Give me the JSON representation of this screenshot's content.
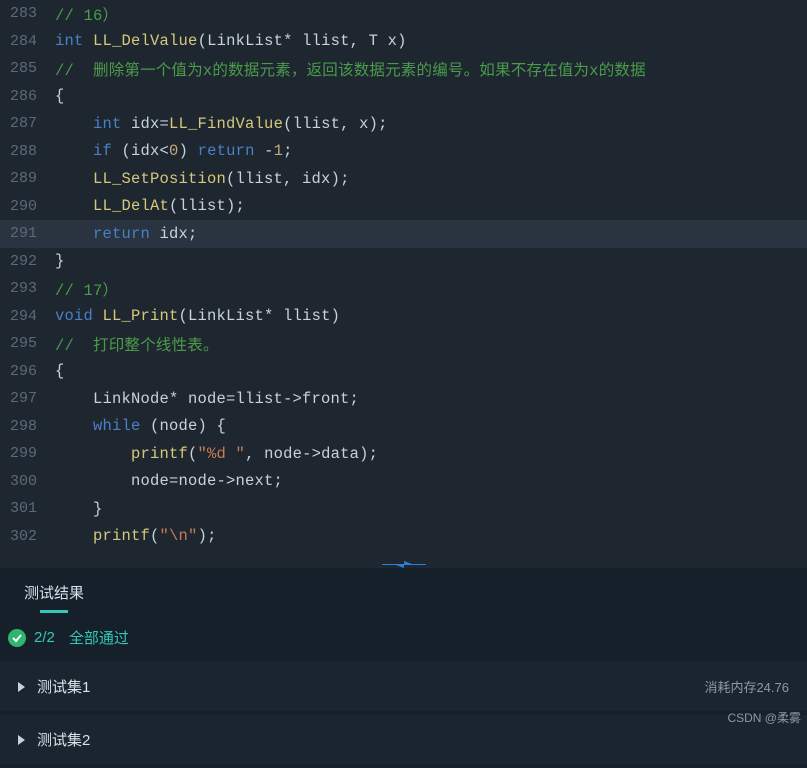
{
  "code": {
    "lines": [
      {
        "num": "283",
        "active": false,
        "tokens": [
          {
            "t": "// 16）",
            "c": "tok-com"
          }
        ]
      },
      {
        "num": "284",
        "active": false,
        "tokens": [
          {
            "t": "int",
            "c": "tok-kw"
          },
          {
            "t": " ",
            "c": "tok-op"
          },
          {
            "t": "LL_DelValue",
            "c": "tok-fn"
          },
          {
            "t": "(LinkList* llist, T x)",
            "c": "tok-pun"
          }
        ]
      },
      {
        "num": "285",
        "active": false,
        "tokens": [
          {
            "t": "//  删除第一个值为x的数据元素，返回该数据元素的编号。如果不存在值为x的数据",
            "c": "tok-com"
          }
        ]
      },
      {
        "num": "286",
        "active": false,
        "tokens": [
          {
            "t": "{",
            "c": "tok-pun"
          }
        ]
      },
      {
        "num": "287",
        "active": false,
        "tokens": [
          {
            "t": "    ",
            "c": "tok-op"
          },
          {
            "t": "int",
            "c": "tok-kw"
          },
          {
            "t": " idx=",
            "c": "tok-id"
          },
          {
            "t": "LL_FindValue",
            "c": "tok-fn"
          },
          {
            "t": "(llist, x);",
            "c": "tok-pun"
          }
        ]
      },
      {
        "num": "288",
        "active": false,
        "tokens": [
          {
            "t": "    ",
            "c": "tok-op"
          },
          {
            "t": "if",
            "c": "tok-kw"
          },
          {
            "t": " (idx<",
            "c": "tok-pun"
          },
          {
            "t": "0",
            "c": "tok-num"
          },
          {
            "t": ") ",
            "c": "tok-pun"
          },
          {
            "t": "return",
            "c": "tok-kw"
          },
          {
            "t": " -",
            "c": "tok-pun"
          },
          {
            "t": "1",
            "c": "tok-num"
          },
          {
            "t": ";",
            "c": "tok-pun"
          }
        ]
      },
      {
        "num": "289",
        "active": false,
        "tokens": [
          {
            "t": "    ",
            "c": "tok-op"
          },
          {
            "t": "LL_SetPosition",
            "c": "tok-fn"
          },
          {
            "t": "(llist, idx);",
            "c": "tok-pun"
          }
        ]
      },
      {
        "num": "290",
        "active": false,
        "tokens": [
          {
            "t": "    ",
            "c": "tok-op"
          },
          {
            "t": "LL_DelAt",
            "c": "tok-fn"
          },
          {
            "t": "(llist);",
            "c": "tok-pun"
          }
        ]
      },
      {
        "num": "291",
        "active": true,
        "tokens": [
          {
            "t": "    ",
            "c": "tok-op"
          },
          {
            "t": "return",
            "c": "tok-kw"
          },
          {
            "t": " idx;",
            "c": "tok-pun"
          }
        ]
      },
      {
        "num": "292",
        "active": false,
        "tokens": [
          {
            "t": "}",
            "c": "tok-pun"
          }
        ]
      },
      {
        "num": "293",
        "active": false,
        "tokens": [
          {
            "t": "// 17）",
            "c": "tok-com"
          }
        ]
      },
      {
        "num": "294",
        "active": false,
        "tokens": [
          {
            "t": "void",
            "c": "tok-kw"
          },
          {
            "t": " ",
            "c": "tok-op"
          },
          {
            "t": "LL_Print",
            "c": "tok-fn"
          },
          {
            "t": "(LinkList* llist)",
            "c": "tok-pun"
          }
        ]
      },
      {
        "num": "295",
        "active": false,
        "tokens": [
          {
            "t": "//  打印整个线性表。",
            "c": "tok-com"
          }
        ]
      },
      {
        "num": "296",
        "active": false,
        "tokens": [
          {
            "t": "{",
            "c": "tok-pun"
          }
        ]
      },
      {
        "num": "297",
        "active": false,
        "tokens": [
          {
            "t": "    LinkNode* node=llist->front;",
            "c": "tok-id"
          }
        ]
      },
      {
        "num": "298",
        "active": false,
        "tokens": [
          {
            "t": "    ",
            "c": "tok-op"
          },
          {
            "t": "while",
            "c": "tok-kw"
          },
          {
            "t": " (node) {",
            "c": "tok-pun"
          }
        ]
      },
      {
        "num": "299",
        "active": false,
        "tokens": [
          {
            "t": "        ",
            "c": "tok-op"
          },
          {
            "t": "printf",
            "c": "tok-fn"
          },
          {
            "t": "(",
            "c": "tok-pun"
          },
          {
            "t": "\"%d \"",
            "c": "tok-str"
          },
          {
            "t": ", node->data);",
            "c": "tok-pun"
          }
        ]
      },
      {
        "num": "300",
        "active": false,
        "tokens": [
          {
            "t": "        node=node->next;",
            "c": "tok-id"
          }
        ]
      },
      {
        "num": "301",
        "active": false,
        "tokens": [
          {
            "t": "    }",
            "c": "tok-pun"
          }
        ]
      },
      {
        "num": "302",
        "active": false,
        "tokens": [
          {
            "t": "    ",
            "c": "tok-op"
          },
          {
            "t": "printf",
            "c": "tok-fn"
          },
          {
            "t": "(",
            "c": "tok-pun"
          },
          {
            "t": "\"\\n\"",
            "c": "tok-str"
          },
          {
            "t": ");",
            "c": "tok-pun"
          }
        ]
      }
    ]
  },
  "panel": {
    "tab_label": "测试结果",
    "count": "2/2",
    "status_label": "全部通过",
    "tests": [
      {
        "name": "测试集1",
        "mem": "消耗内存24.76"
      },
      {
        "name": "测试集2",
        "mem": ""
      }
    ]
  },
  "watermark": "CSDN @柔雾"
}
